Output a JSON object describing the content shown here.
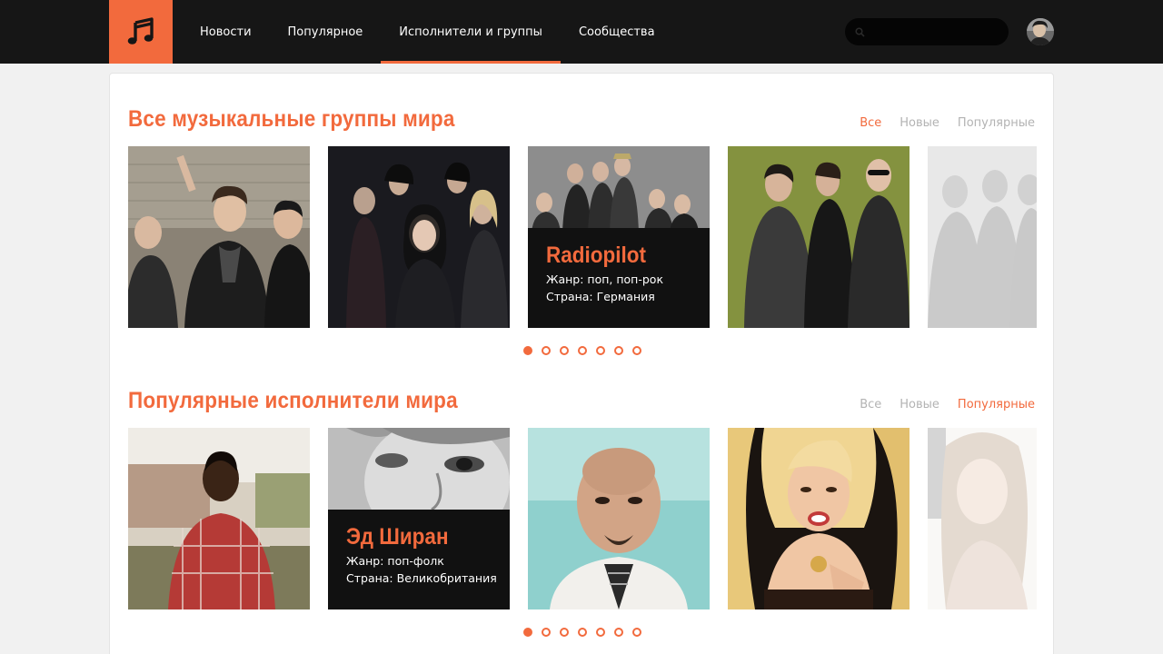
{
  "colors": {
    "accent": "#f26a3d",
    "topbar": "#161616"
  },
  "header": {
    "logo_icon": "music-note-icon",
    "nav": [
      {
        "label": "Новости"
      },
      {
        "label": "Популярное"
      },
      {
        "label": "Исполнители и группы",
        "active": true
      },
      {
        "label": "Сообщества"
      }
    ],
    "search": {
      "placeholder": "",
      "icon": "search-icon"
    },
    "avatar_icon": "user-avatar"
  },
  "sections": [
    {
      "title": "Все музыкальные группы мира",
      "filters": [
        {
          "label": "Все",
          "active": true
        },
        {
          "label": "Новые",
          "active": false
        },
        {
          "label": "Популярные",
          "active": false
        }
      ],
      "overlay": {
        "name": "Radiopilot",
        "genre": "Жанр: поп, поп-рок",
        "country": "Страна: Германия"
      },
      "dots": {
        "count": 7,
        "active_index": 0
      }
    },
    {
      "title": "Популярные исполнители мира",
      "filters": [
        {
          "label": "Все",
          "active": false
        },
        {
          "label": "Новые",
          "active": false
        },
        {
          "label": "Популярные",
          "active": true
        }
      ],
      "overlay": {
        "name": "Эд Ширан",
        "genre": "Жанр: поп-фолк",
        "country": "Страна: Великобритания"
      },
      "dots": {
        "count": 7,
        "active_index": 0
      }
    }
  ]
}
